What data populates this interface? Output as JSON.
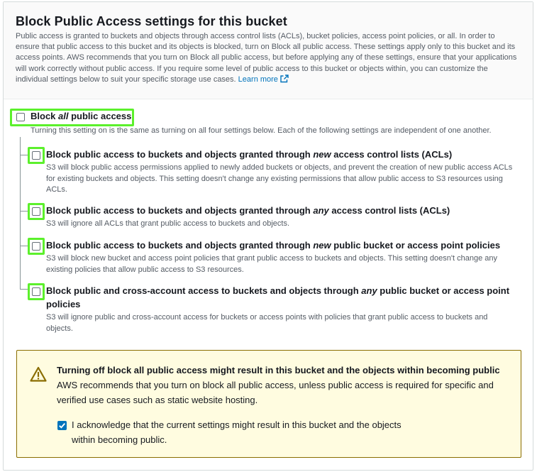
{
  "header": {
    "title": "Block Public Access settings for this bucket",
    "description": "Public access is granted to buckets and objects through access control lists (ACLs), bucket policies, access point policies, or all. In order to ensure that public access to this bucket and its objects is blocked, turn on Block all public access. These settings apply only to this bucket and its access points. AWS recommends that you turn on Block all public access, but before applying any of these settings, ensure that your applications will work correctly without public access. If you require some level of public access to this bucket or objects within, you can customize the individual settings below to suit your specific storage use cases.",
    "learn_more": "Learn more"
  },
  "block_all": {
    "label_pre": "Block ",
    "label_em": "all",
    "label_post": " public access",
    "description": "Turning this setting on is the same as turning on all four settings below. Each of the following settings are independent of one another.",
    "checked": false
  },
  "options": [
    {
      "label_pre": "Block public access to buckets and objects granted through ",
      "label_em": "new",
      "label_post": " access control lists (ACLs)",
      "description": "S3 will block public access permissions applied to newly added buckets or objects, and prevent the creation of new public access ACLs for existing buckets and objects. This setting doesn't change any existing permissions that allow public access to S3 resources using ACLs.",
      "checked": false
    },
    {
      "label_pre": "Block public access to buckets and objects granted through ",
      "label_em": "any",
      "label_post": " access control lists (ACLs)",
      "description": "S3 will ignore all ACLs that grant public access to buckets and objects.",
      "checked": false
    },
    {
      "label_pre": "Block public access to buckets and objects granted through ",
      "label_em": "new",
      "label_post": " public bucket or access point policies",
      "description": "S3 will block new bucket and access point policies that grant public access to buckets and objects. This setting doesn't change any existing policies that allow public access to S3 resources.",
      "checked": false
    },
    {
      "label_pre": "Block public and cross-account access to buckets and objects through ",
      "label_em": "any",
      "label_post": " public bucket or access point policies",
      "description": "S3 will ignore public and cross-account access for buckets or access points with policies that grant public access to buckets and objects.",
      "checked": false
    }
  ],
  "warning": {
    "title": "Turning off block all public access might result in this bucket and the objects within becoming public",
    "text": "AWS recommends that you turn on block all public access, unless public access is required for specific and verified use cases such as static website hosting.",
    "acknowledge": "I acknowledge that the current settings might result in this bucket and the objects within becoming public.",
    "acknowledge_checked": true
  },
  "colors": {
    "highlight": "#5cf02c",
    "link": "#0073bb",
    "warning_bg": "#fffce0",
    "warning_border": "#8a6d00"
  },
  "icons": [
    "external-link-icon",
    "warning-icon",
    "checkmark-icon"
  ]
}
